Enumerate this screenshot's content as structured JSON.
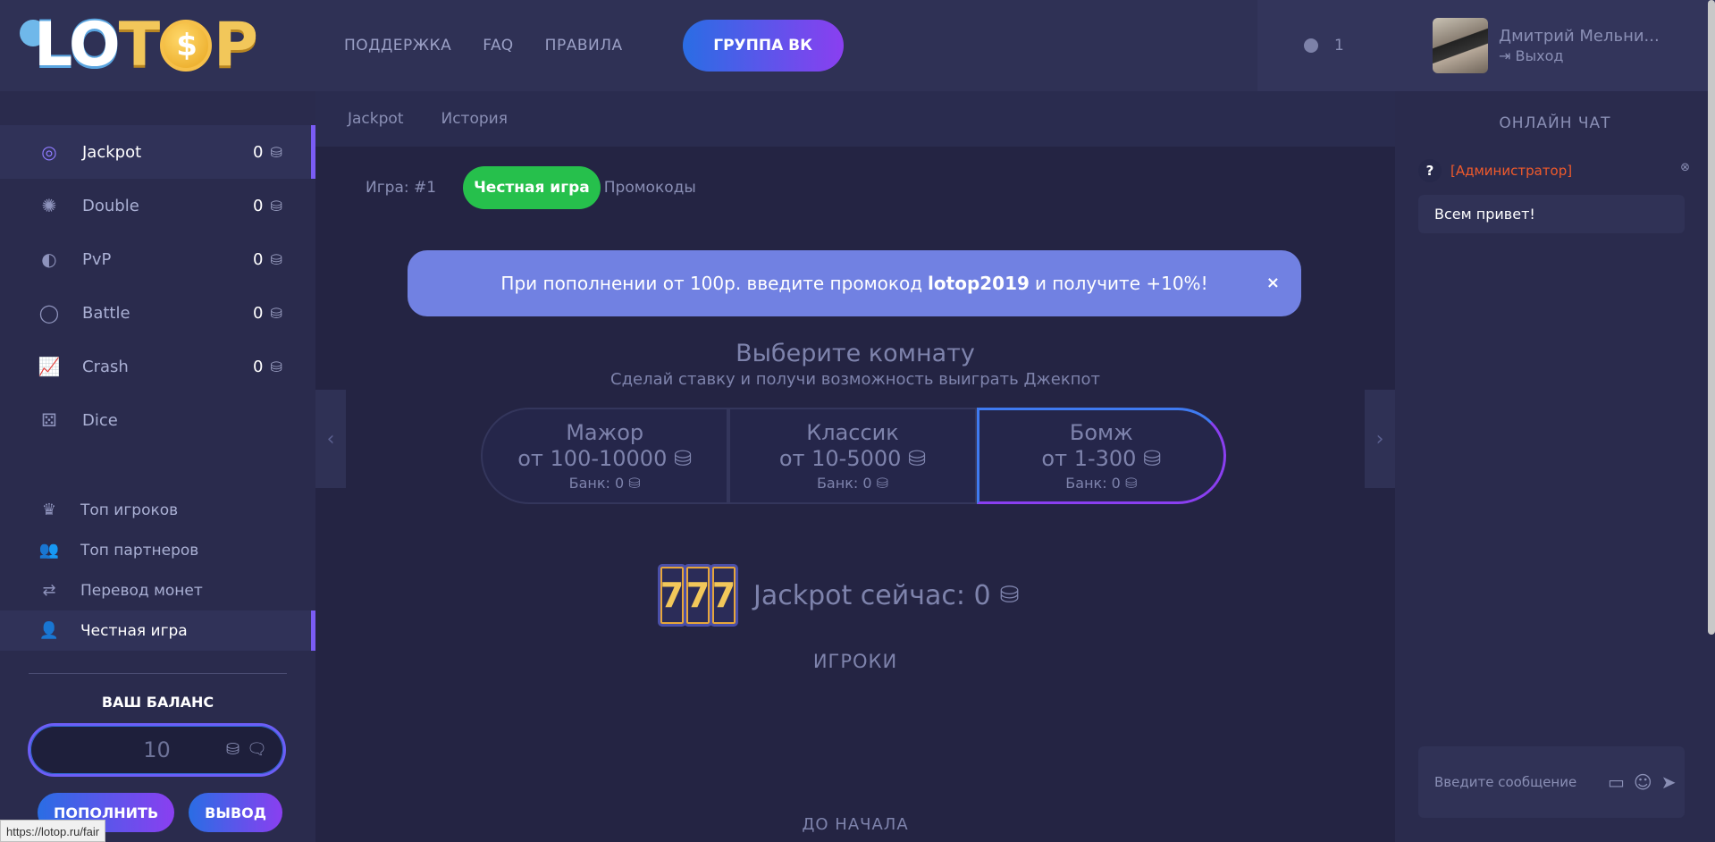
{
  "logo": {
    "letters_left": "LO",
    "coin": "$",
    "letters_right": "P"
  },
  "nav_games": [
    {
      "label": "Jackpot",
      "count": "0",
      "icon": "target-icon",
      "active": true
    },
    {
      "label": "Double",
      "count": "0",
      "icon": "wheel-icon",
      "active": false
    },
    {
      "label": "PvP",
      "count": "0",
      "icon": "half-circle-icon",
      "active": false
    },
    {
      "label": "Battle",
      "count": "0",
      "icon": "ring-icon",
      "active": false
    },
    {
      "label": "Crash",
      "count": "0",
      "icon": "chart-icon",
      "active": false
    },
    {
      "label": "Dice",
      "count": "",
      "icon": "dice-icon",
      "active": false
    }
  ],
  "nav_extra": [
    {
      "label": "Топ игроков",
      "icon": "crown-icon",
      "active": false
    },
    {
      "label": "Топ партнеров",
      "icon": "users-icon",
      "active": false
    },
    {
      "label": "Перевод монет",
      "icon": "transfer-icon",
      "active": false
    },
    {
      "label": "Честная игра",
      "icon": "user-shield-icon",
      "active": true
    }
  ],
  "balance": {
    "title": "ВАШ БАЛАНС",
    "value": "10",
    "deposit_label": "ПОПОЛНИТЬ",
    "withdraw_label": "ВЫВОД"
  },
  "status_url": "https://lotop.ru/fair",
  "header": {
    "links": [
      "ПОДДЕРЖКА",
      "FAQ",
      "ПРАВИЛА"
    ],
    "vk_label": "ГРУППА ВК",
    "online": "1"
  },
  "subnav": [
    "Jackpot",
    "История"
  ],
  "game": {
    "label": "Игра: #1",
    "fair_label": "Честная игра",
    "promo_label": "Промокоды"
  },
  "banner": {
    "text_before": "При пополнении от 100р. введите промокод",
    "code": "lotop2019",
    "text_after": "и получите +10%!",
    "close": "×"
  },
  "rooms": {
    "title": "Выберите комнату",
    "subtitle": "Сделай ставку и получи возможность выиграть Джекпот",
    "items": [
      {
        "name": "Мажор",
        "range": "от 100-10000",
        "bank": "Банк: 0",
        "selected": false
      },
      {
        "name": "Классик",
        "range": "от 10-5000",
        "bank": "Банк: 0",
        "selected": false
      },
      {
        "name": "Бомж",
        "range": "от 1-300",
        "bank": "Банк: 0",
        "selected": true
      }
    ]
  },
  "jackpot": {
    "slots": [
      "7",
      "7",
      "7"
    ],
    "label": "Jackpot сейчас: 0"
  },
  "players_title": "ИГРОКИ",
  "start_title": "ДО НАЧАЛА",
  "user": {
    "name": "Дмитрий Мельни...",
    "logout": "Выход"
  },
  "chat": {
    "title": "ОНЛАЙН ЧАТ",
    "messages": [
      {
        "avatar": "?",
        "role": "[Администратор]",
        "text": "Всем привет!"
      }
    ],
    "placeholder": "Введите сообщение"
  }
}
